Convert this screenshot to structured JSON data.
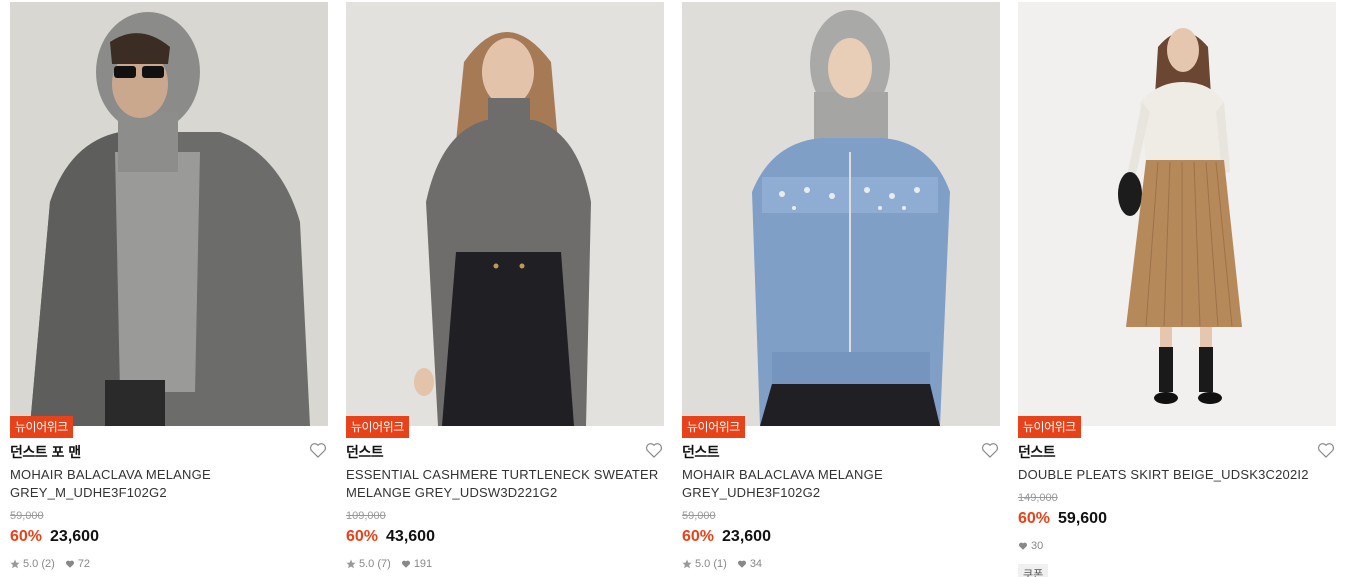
{
  "products": [
    {
      "badge": "뉴이어위크",
      "brand": "던스트 포 맨",
      "name": "MOHAIR BALACLAVA MELANGE GREY_M_UDHE3F102G2",
      "original_price": "59,000",
      "discount": "60%",
      "price": "23,600",
      "rating": "5.0",
      "reviews": "(2)",
      "likes": "72"
    },
    {
      "badge": "뉴이어위크",
      "brand": "던스트",
      "name": "ESSENTIAL CASHMERE TURTLENECK SWEATER MELANGE GREY_UDSW3D221G2",
      "original_price": "109,000",
      "discount": "60%",
      "price": "43,600",
      "rating": "5.0",
      "reviews": "(7)",
      "likes": "191"
    },
    {
      "badge": "뉴이어위크",
      "brand": "던스트",
      "name": "MOHAIR BALACLAVA MELANGE GREY_UDHE3F102G2",
      "original_price": "59,000",
      "discount": "60%",
      "price": "23,600",
      "rating": "5.0",
      "reviews": "(1)",
      "likes": "34"
    },
    {
      "badge": "뉴이어위크",
      "brand": "던스트",
      "name": "DOUBLE PLEATS SKIRT BEIGE_UDSK3C202I2",
      "original_price": "149,000",
      "discount": "60%",
      "price": "59,600",
      "likes": "30",
      "coupon": "쿠폰"
    }
  ],
  "icons": {
    "wishlist": "heart-outline-icon",
    "rating": "star-icon",
    "likes": "heart-filled-icon"
  },
  "colors": {
    "accent": "#e8421a",
    "muted": "#999999"
  }
}
